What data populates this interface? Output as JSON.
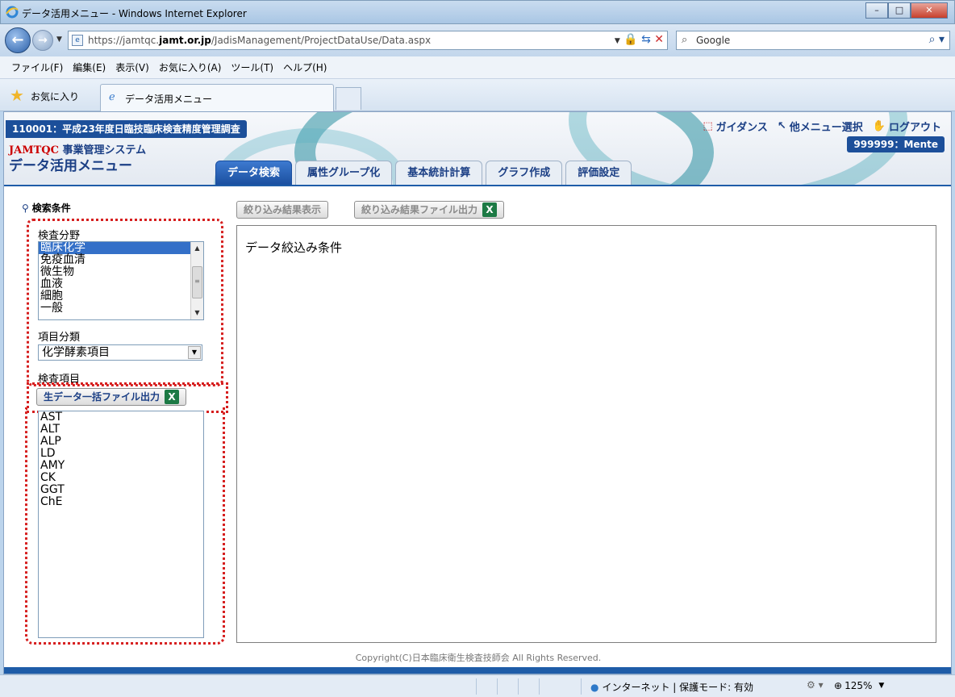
{
  "window": {
    "title": "データ活用メニュー - Windows Internet Explorer",
    "min_label": "–",
    "max_label": "□",
    "close_label": "✕"
  },
  "address": {
    "url_prefix": "https://jamtqc.",
    "url_domain": "jamt.or.jp",
    "url_path": "/JadisManagement/ProjectDataUse/Data.aspx",
    "search_placeholder": "Google"
  },
  "menubar": [
    "ファイル(F)",
    "編集(E)",
    "表示(V)",
    "お気に入り(A)",
    "ツール(T)",
    "ヘルプ(H)"
  ],
  "favorites": {
    "label": "お気に入り",
    "tab_label": "データ活用メニュー"
  },
  "header": {
    "project": "110001：平成23年度日臨技臨床検査精度管理調査",
    "sys_brand": "JAMTQC",
    "sys_name": "事業管理システム",
    "menu_title": "データ活用メニュー",
    "links": [
      "ガイダンス",
      "他メニュー選択",
      "ログアウト"
    ],
    "user": "999999：Mente",
    "tabs": [
      "データ検索",
      "属性グループ化",
      "基本統計計算",
      "グラフ作成",
      "評価設定"
    ],
    "active_tab": 0
  },
  "left": {
    "search_title": "検索条件",
    "field_label": "検査分野",
    "fields": [
      "臨床化学",
      "免疫血清",
      "微生物",
      "血液",
      "細胞",
      "一般"
    ],
    "selected_field": 0,
    "category_label": "項目分類",
    "category_value": "化学酵素項目",
    "items_label": "検査項目",
    "export_button": "生データ一括ファイル出力",
    "items": [
      "AST",
      "ALT",
      "ALP",
      "LD",
      "AMY",
      "CK",
      "GGT",
      "ChE"
    ]
  },
  "main": {
    "filter_button": "絞り込み結果表示",
    "filter_export_button": "絞り込み結果ファイル出力",
    "panel_title": "データ絞込み条件"
  },
  "footer": {
    "copyright": "Copyright(C)日本臨床衛生検査技師会 All Rights Reserved."
  },
  "status": {
    "zone": "インターネット | 保護モード: 有効",
    "zoom": "125%"
  }
}
